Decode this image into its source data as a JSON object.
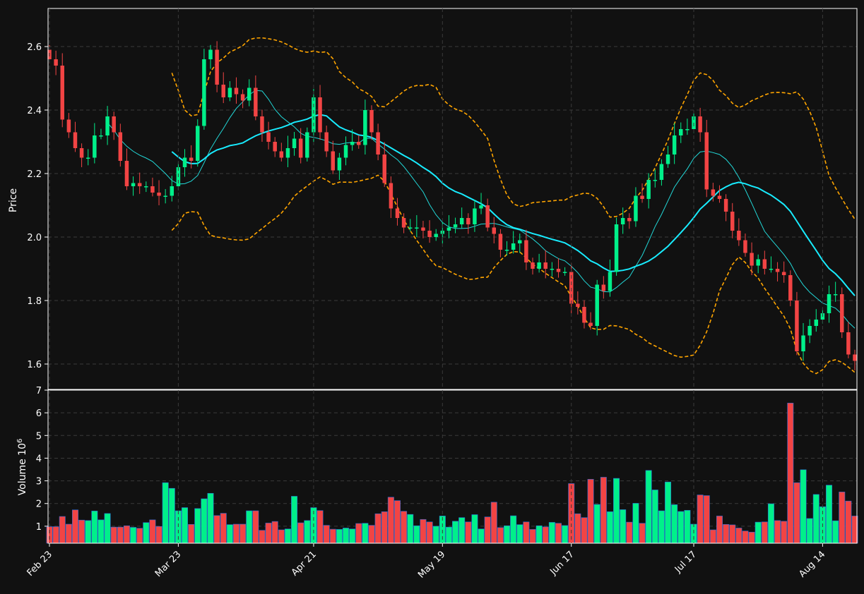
{
  "chart_data": [
    {
      "type": "candlestick",
      "panel": "price",
      "ylabel": "Price",
      "ylim": [
        1.52,
        2.72
      ],
      "yticks": [
        "1.6",
        "1.8",
        "2.0",
        "2.2",
        "2.4",
        "2.6"
      ],
      "grid": true,
      "colors": {
        "up": "#00f08a",
        "down": "#f24444",
        "mav_short": "#22d8d8",
        "mav_long": "#18ecff",
        "bands": "#ffa500",
        "background": "#111111",
        "grid": "#3a3a3a"
      },
      "series_lines": [
        "short moving average",
        "long moving average",
        "upper band",
        "lower band"
      ],
      "dates": [
        "2022-02-23",
        "2022-02-24",
        "2022-02-25",
        "2022-02-28",
        "2022-03-01",
        "2022-03-02",
        "2022-03-03",
        "2022-03-04",
        "2022-03-07",
        "2022-03-08",
        "2022-03-09",
        "2022-03-10",
        "2022-03-11",
        "2022-03-14",
        "2022-03-15",
        "2022-03-16",
        "2022-03-17",
        "2022-03-18",
        "2022-03-21",
        "2022-03-22",
        "2022-03-23",
        "2022-03-24",
        "2022-03-25",
        "2022-03-28",
        "2022-03-29",
        "2022-03-30",
        "2022-03-31",
        "2022-04-01",
        "2022-04-04",
        "2022-04-05",
        "2022-04-06",
        "2022-04-07",
        "2022-04-08",
        "2022-04-11",
        "2022-04-12",
        "2022-04-13",
        "2022-04-14",
        "2022-04-15",
        "2022-04-18",
        "2022-04-19",
        "2022-04-20",
        "2022-04-21",
        "2022-04-22",
        "2022-04-25",
        "2022-04-26",
        "2022-04-27",
        "2022-04-28",
        "2022-04-29",
        "2022-05-02",
        "2022-05-03",
        "2022-05-04",
        "2022-05-05",
        "2022-05-06",
        "2022-05-09",
        "2022-05-10",
        "2022-05-11",
        "2022-05-12",
        "2022-05-13",
        "2022-05-16",
        "2022-05-17",
        "2022-05-18",
        "2022-05-19",
        "2022-05-20",
        "2022-05-23",
        "2022-05-24",
        "2022-05-25",
        "2022-05-26",
        "2022-05-27",
        "2022-05-31",
        "2022-06-01",
        "2022-06-02",
        "2022-06-03",
        "2022-06-06",
        "2022-06-07",
        "2022-06-08",
        "2022-06-09",
        "2022-06-10",
        "2022-06-13",
        "2022-06-14",
        "2022-06-15",
        "2022-06-16",
        "2022-06-17",
        "2022-06-21",
        "2022-06-22",
        "2022-06-23",
        "2022-06-24",
        "2022-06-27",
        "2022-06-28",
        "2022-06-29",
        "2022-06-30",
        "2022-07-01",
        "2022-07-05",
        "2022-07-06",
        "2022-07-07",
        "2022-07-08",
        "2022-07-11",
        "2022-07-12",
        "2022-07-13",
        "2022-07-14",
        "2022-07-15",
        "2022-07-18",
        "2022-07-19",
        "2022-07-20",
        "2022-07-21",
        "2022-07-22",
        "2022-07-25",
        "2022-07-26",
        "2022-07-27",
        "2022-07-28",
        "2022-07-29",
        "2022-08-01",
        "2022-08-02",
        "2022-08-03",
        "2022-08-04",
        "2022-08-05",
        "2022-08-08",
        "2022-08-09",
        "2022-08-10",
        "2022-08-11",
        "2022-08-12",
        "2022-08-15",
        "2022-08-16",
        "2022-08-17",
        "2022-08-18",
        "2022-08-19",
        "2022-08-22"
      ],
      "open": [
        2.59,
        2.56,
        2.54,
        2.37,
        2.33,
        2.28,
        2.25,
        2.25,
        2.32,
        2.32,
        2.38,
        2.33,
        2.24,
        2.16,
        2.17,
        2.16,
        2.16,
        2.14,
        2.13,
        2.13,
        2.16,
        2.22,
        2.25,
        2.24,
        2.35,
        2.56,
        2.59,
        2.48,
        2.44,
        2.47,
        2.45,
        2.43,
        2.47,
        2.38,
        2.33,
        2.3,
        2.27,
        2.25,
        2.28,
        2.31,
        2.25,
        2.33,
        2.44,
        2.33,
        2.27,
        2.21,
        2.25,
        2.29,
        2.3,
        2.29,
        2.4,
        2.33,
        2.26,
        2.17,
        2.09,
        2.06,
        2.03,
        2.03,
        2.03,
        2.02,
        2.0,
        2.01,
        2.02,
        2.03,
        2.04,
        2.06,
        2.04,
        2.09,
        2.1,
        2.03,
        2.01,
        1.96,
        1.96,
        1.98,
        1.99,
        1.92,
        1.9,
        1.92,
        1.9,
        1.9,
        1.89,
        1.89,
        1.79,
        1.78,
        1.73,
        1.72,
        1.85,
        1.83,
        1.89,
        2.04,
        2.06,
        2.05,
        2.13,
        2.12,
        2.18,
        2.18,
        2.23,
        2.26,
        2.32,
        2.34,
        2.34,
        2.38,
        2.33,
        2.15,
        2.13,
        2.12,
        2.08,
        2.02,
        1.99,
        1.95,
        1.91,
        1.93,
        1.9,
        1.9,
        1.89,
        1.88,
        1.8,
        1.64,
        1.69,
        1.72,
        1.74,
        1.76,
        1.82,
        1.82,
        1.7,
        1.63
      ]
    },
    {
      "type": "bar",
      "panel": "volume",
      "ylabel": "Volume  10",
      "ylabel_exponent": "6",
      "ylim": [
        0.25,
        7
      ],
      "yticks": [
        "1",
        "2",
        "3",
        "4",
        "5",
        "6",
        "7"
      ],
      "grid": true,
      "values_millions": [
        0.98,
        0.98,
        1.43,
        1.09,
        1.72,
        1.27,
        1.25,
        1.67,
        1.28,
        1.56,
        0.96,
        0.96,
        1.02,
        0.95,
        0.91,
        1.16,
        1.28,
        0.99,
        2.92,
        2.67,
        1.68,
        1.82,
        1.08,
        1.78,
        2.21,
        2.45,
        1.47,
        1.57,
        1.07,
        1.09,
        1.09,
        1.68,
        1.68,
        0.82,
        1.14,
        1.21,
        0.84,
        0.88,
        2.32,
        1.15,
        1.25,
        1.82,
        1.69,
        1.04,
        0.87,
        0.86,
        0.92,
        0.88,
        1.12,
        1.13,
        1.04,
        1.55,
        1.64,
        2.28,
        2.13,
        1.66,
        1.52,
        1.02,
        1.3,
        1.19,
        1.0,
        1.45,
        0.96,
        1.22,
        1.38,
        1.19,
        1.51,
        0.88,
        1.41,
        2.06,
        0.94,
        1.02,
        1.46,
        1.07,
        1.19,
        0.86,
        1.02,
        0.97,
        1.17,
        1.13,
        1.03,
        2.88,
        1.55,
        1.38,
        3.07,
        1.96,
        3.16,
        1.64,
        3.11,
        1.73,
        1.18,
        2.01,
        1.13,
        3.46,
        2.6,
        1.68,
        2.95,
        1.95,
        1.65,
        1.7,
        1.09,
        2.38,
        2.35,
        0.84,
        1.45,
        1.08,
        1.06,
        0.92,
        0.79,
        0.74,
        1.18,
        1.19,
        1.99,
        1.25,
        1.22,
        6.43,
        2.92,
        3.49,
        1.34,
        2.4,
        1.86,
        2.81,
        1.24,
        2.51,
        2.11,
        1.45
      ],
      "x_tick_labels": [
        "Feb 23",
        "Mar 23",
        "Apr 21",
        "May 19",
        "Jun 17",
        "Jul 17",
        "Aug 14"
      ]
    }
  ]
}
